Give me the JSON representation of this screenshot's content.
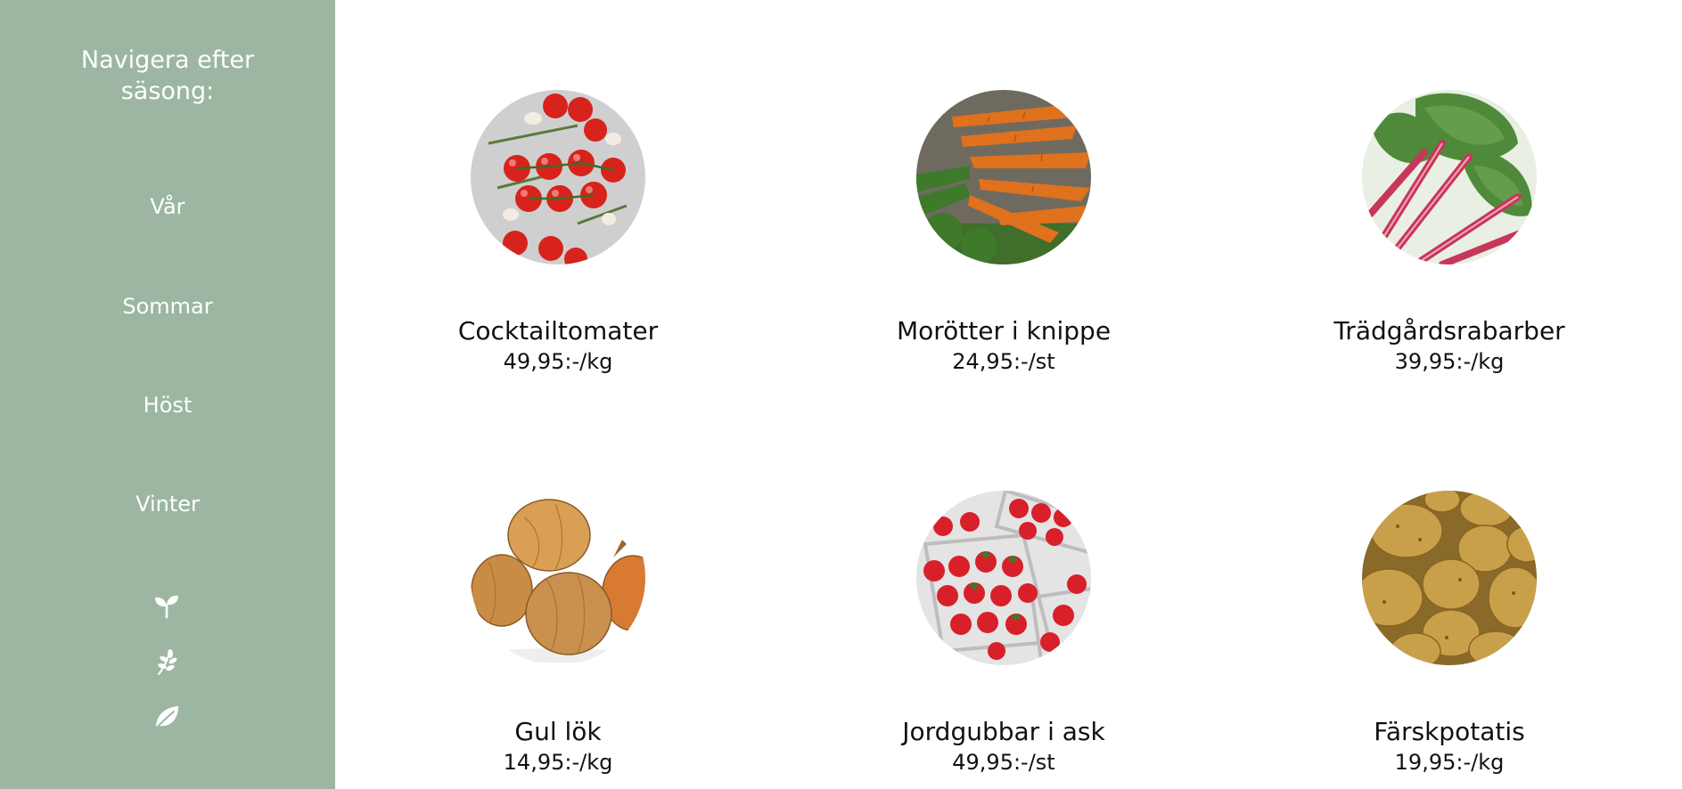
{
  "sidebar": {
    "title": "Navigera efter\nsäsong:",
    "seasons": [
      "Vår",
      "Sommar",
      "Höst",
      "Vinter"
    ],
    "icons": [
      "sprout-icon",
      "leafy-sprig-icon",
      "leaf-icon"
    ]
  },
  "colors": {
    "sidebar_bg": "#9cb6a2",
    "text": "#111111"
  },
  "products": [
    {
      "name": "Cocktailtomater",
      "price": "49,95:-/kg",
      "image": "cherry-tomatoes-photo"
    },
    {
      "name": "Morötter i knippe",
      "price": "24,95:-/st",
      "image": "carrots-photo"
    },
    {
      "name": "Trädgårdsrabarber",
      "price": "39,95:-/kg",
      "image": "rhubarb-photo"
    },
    {
      "name": "Gul lök",
      "price": "14,95:-/kg",
      "image": "yellow-onions-photo"
    },
    {
      "name": "Jordgubbar i ask",
      "price": "49,95:-/st",
      "image": "strawberries-photo"
    },
    {
      "name": "Färskpotatis",
      "price": "19,95:-/kg",
      "image": "new-potatoes-photo"
    }
  ]
}
